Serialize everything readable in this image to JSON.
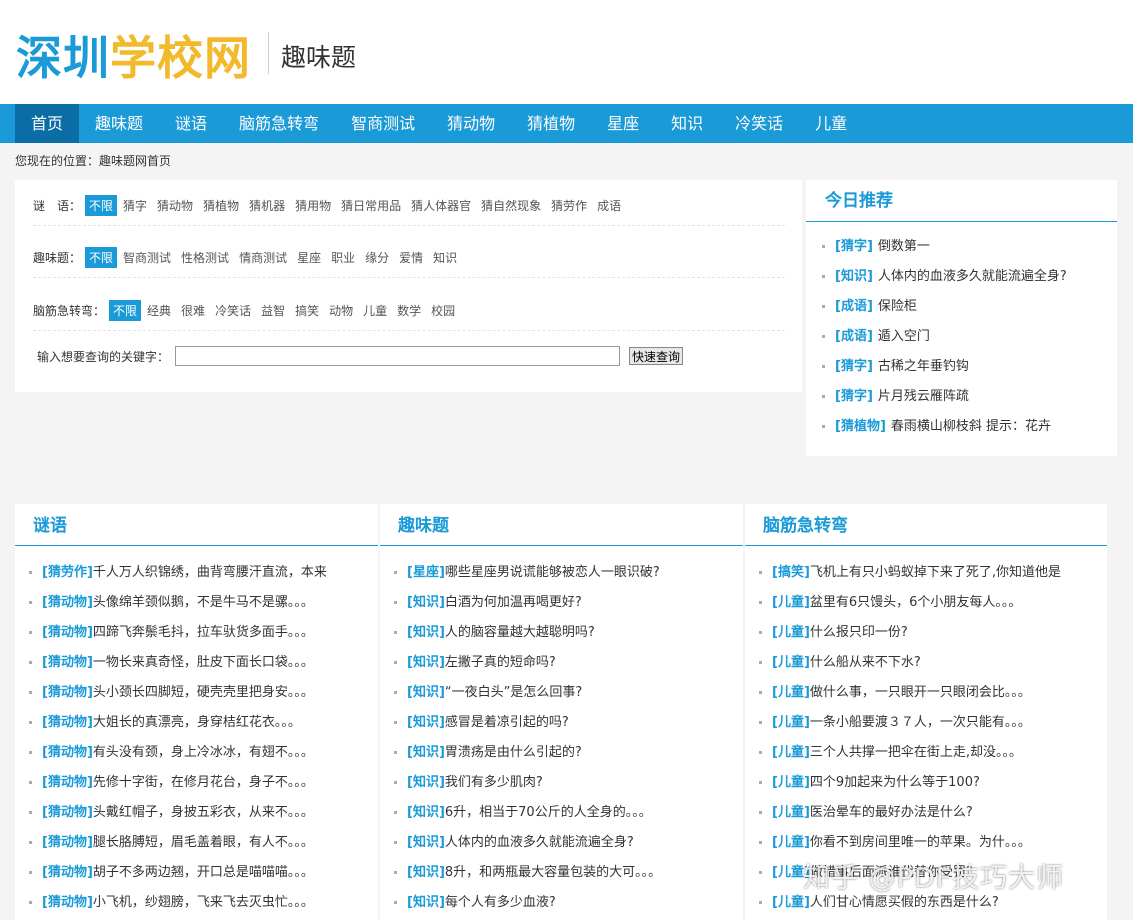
{
  "site": {
    "logo_part1": "深圳",
    "logo_part2": "学校网",
    "subtitle": "趣味题"
  },
  "nav": [
    "首页",
    "趣味题",
    "谜语",
    "脑筋急转弯",
    "智商测试",
    "猜动物",
    "猜植物",
    "星座",
    "知识",
    "冷笑话",
    "儿童"
  ],
  "breadcrumb": "您现在的位置：趣味题网首页",
  "filters": [
    {
      "label": "谜　语：",
      "options": [
        "不限",
        "猜字",
        "猜动物",
        "猜植物",
        "猜机器",
        "猜用物",
        "猜日常用品",
        "猜人体器官",
        "猜自然现象",
        "猜劳作",
        "成语"
      ]
    },
    {
      "label": "趣味题：",
      "options": [
        "不限",
        "智商测试",
        "性格测试",
        "情商测试",
        "星座",
        "职业",
        "缘分",
        "爱情",
        "知识"
      ]
    },
    {
      "label": "脑筋急转弯：",
      "options": [
        "不限",
        "经典",
        "很难",
        "冷笑话",
        "益智",
        "搞笑",
        "动物",
        "儿童",
        "数学",
        "校园"
      ]
    }
  ],
  "search": {
    "label": "输入想要查询的关键字：",
    "value": "",
    "button": "快速查询"
  },
  "today": {
    "title": "今日推荐",
    "items": [
      {
        "tag": "[猜字]",
        "text": "倒数第一"
      },
      {
        "tag": "[知识]",
        "text": "人体内的血液多久就能流遍全身?"
      },
      {
        "tag": "[成语]",
        "text": "保险柜"
      },
      {
        "tag": "[成语]",
        "text": "遁入空门"
      },
      {
        "tag": "[猜字]",
        "text": "古稀之年垂钓钩"
      },
      {
        "tag": "[猜字]",
        "text": "片月残云雁阵疏"
      },
      {
        "tag": "[猜植物]",
        "text": "春雨横山柳枝斜 提示：花卉"
      }
    ]
  },
  "columns": [
    {
      "title": "谜语",
      "items": [
        {
          "tag": "[猜劳作]",
          "text": "千人万人织锦绣，曲背弯腰汗直流，本来"
        },
        {
          "tag": "[猜动物]",
          "text": "头像绵羊颈似鹅，不是牛马不是骡。。。"
        },
        {
          "tag": "[猜动物]",
          "text": "四蹄飞奔鬃毛抖，拉车驮货多面手。。。"
        },
        {
          "tag": "[猜动物]",
          "text": "一物长来真奇怪，肚皮下面长口袋。。。"
        },
        {
          "tag": "[猜动物]",
          "text": "头小颈长四脚短，硬壳壳里把身安。。。"
        },
        {
          "tag": "[猜动物]",
          "text": "大姐长的真漂亮，身穿桔红花衣。。。"
        },
        {
          "tag": "[猜动物]",
          "text": "有头没有颈，身上冷冰冰，有翅不。。。"
        },
        {
          "tag": "[猜动物]",
          "text": "先修十字街，在修月花台，身子不。。。"
        },
        {
          "tag": "[猜动物]",
          "text": "头戴红帽子，身披五彩衣，从来不。。。"
        },
        {
          "tag": "[猜动物]",
          "text": "腿长胳膊短，眉毛盖着眼，有人不。。。"
        },
        {
          "tag": "[猜动物]",
          "text": "胡子不多两边翘，开口总是喵喵喵。。。"
        },
        {
          "tag": "[猜动物]",
          "text": "小飞机，纱翅膀，飞来飞去灭虫忙。。。"
        }
      ]
    },
    {
      "title": "趣味题",
      "items": [
        {
          "tag": "[星座]",
          "text": "哪些星座男说谎能够被恋人一眼识破?"
        },
        {
          "tag": "[知识]",
          "text": "白酒为何加温再喝更好?"
        },
        {
          "tag": "[知识]",
          "text": "人的脑容量越大越聪明吗?"
        },
        {
          "tag": "[知识]",
          "text": "左撇子真的短命吗?"
        },
        {
          "tag": "[知识]",
          "text": "“一夜白头”是怎么回事?"
        },
        {
          "tag": "[知识]",
          "text": "感冒是着凉引起的吗?"
        },
        {
          "tag": "[知识]",
          "text": "胃溃疡是由什么引起的?"
        },
        {
          "tag": "[知识]",
          "text": "我们有多少肌肉?"
        },
        {
          "tag": "[知识]",
          "text": "6升，相当于70公斤的人全身的。。。"
        },
        {
          "tag": "[知识]",
          "text": "人体内的血液多久就能流遍全身?"
        },
        {
          "tag": "[知识]",
          "text": "8升，和两瓶最大容量包装的大可。。。"
        },
        {
          "tag": "[知识]",
          "text": "每个人有多少血液?"
        }
      ]
    },
    {
      "title": "脑筋急转弯",
      "items": [
        {
          "tag": "[搞笑]",
          "text": "飞机上有只小蚂蚁掉下来了死了,你知道他是"
        },
        {
          "tag": "[儿童]",
          "text": "盆里有6只馒头，6个小朋友每人。。。"
        },
        {
          "tag": "[儿童]",
          "text": "什么报只印一份?"
        },
        {
          "tag": "[儿童]",
          "text": "什么船从来不下水?"
        },
        {
          "tag": "[儿童]",
          "text": "做什么事，一只眼开一只眼闭会比。。。"
        },
        {
          "tag": "[儿童]",
          "text": "一条小船要渡３７人，一次只能有。。。"
        },
        {
          "tag": "[儿童]",
          "text": "三个人共撑一把伞在街上走,却没。。。"
        },
        {
          "tag": "[儿童]",
          "text": "四个9加起来为什么等于100?"
        },
        {
          "tag": "[儿童]",
          "text": "医治晕车的最好办法是什么?"
        },
        {
          "tag": "[儿童]",
          "text": "你看不到房间里唯一的苹果。为什。。。"
        },
        {
          "tag": "[儿童]",
          "text": "做错事后面派谁代替你受罚?"
        },
        {
          "tag": "[儿童]",
          "text": "人们甘心情愿买假的东西是什么?"
        }
      ]
    }
  ],
  "watermark": "知乎 @PDF技巧大师"
}
